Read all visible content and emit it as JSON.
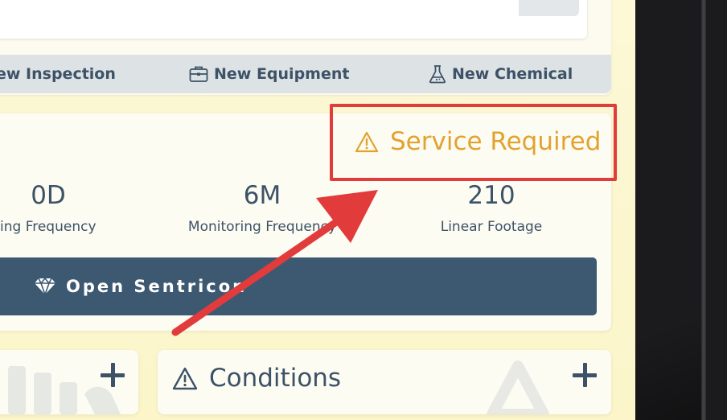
{
  "actions": [
    {
      "label": "ew Inspection",
      "icon": "clipboard-icon"
    },
    {
      "label": "New Equipment",
      "icon": "briefcase-icon"
    },
    {
      "label": "New Chemical",
      "icon": "flask-icon"
    }
  ],
  "status": {
    "label": "Service Required",
    "icon": "warning-icon",
    "color": "#e3a22f"
  },
  "stats": [
    {
      "value": "0D",
      "label": "ing Frequency"
    },
    {
      "value": "6M",
      "label": "Monitoring Frequency"
    },
    {
      "value": "210",
      "label": "Linear Footage"
    }
  ],
  "open_button": {
    "label": "Open Sentricon",
    "icon": "sentricon-icon"
  },
  "conditions": {
    "title": "Conditions",
    "icon": "warning-icon"
  },
  "colors": {
    "highlight": "#e23b3b",
    "button": "#3c5971",
    "text": "#3d5266"
  }
}
